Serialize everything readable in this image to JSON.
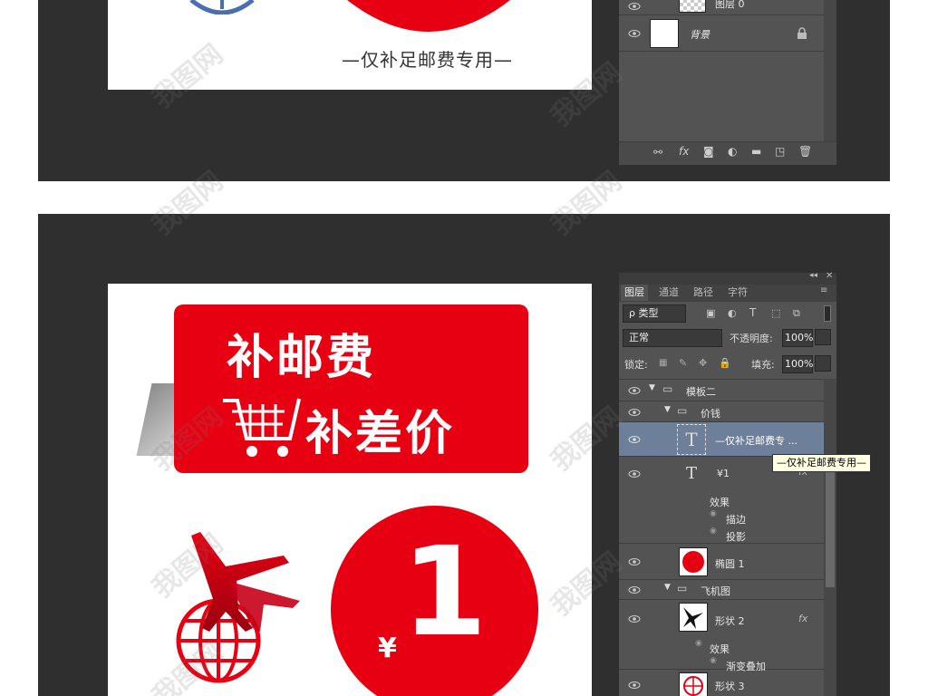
{
  "top_section": {
    "canvas_caption": "—仅补足邮费专用—",
    "layers": [
      {
        "name": "图层 0"
      },
      {
        "name": "背景"
      }
    ],
    "footer_icons": [
      "link-icon",
      "fx-icon",
      "mask-icon",
      "adjustment-icon",
      "folder-icon",
      "new-layer-icon",
      "trash-icon"
    ]
  },
  "bottom_section": {
    "canvas": {
      "banner_line1": "补邮费",
      "banner_line2": "补差价",
      "yen_symbol": "¥",
      "big_number": "1",
      "colors": {
        "brand_red": "#e60012",
        "white": "#ffffff"
      }
    },
    "ps_panel": {
      "tabs": [
        "图层",
        "通道",
        "路径",
        "字符"
      ],
      "filter_label": "ρ 类型",
      "blend_mode": "正常",
      "opacity_label": "不透明度:",
      "opacity_value": "100%",
      "lock_label": "锁定:",
      "fill_label": "填充:",
      "fill_value": "100%",
      "layers": {
        "group_template": "模板二",
        "group_price": "价钱",
        "text_layer_1": "—仅补足邮费专 ...",
        "text_layer_2": "¥1",
        "effects": "效果",
        "stroke": "描边",
        "shadow": "投影",
        "ellipse": "椭圆 1",
        "group_plane": "飞机图",
        "shape2": "形状 2",
        "effects2": "效果",
        "gradient_overlay": "渐变叠加",
        "shape3": "形状 3",
        "fx": "fx"
      },
      "tooltip": "—仅补足邮费专用—"
    }
  },
  "watermark": "我图网"
}
